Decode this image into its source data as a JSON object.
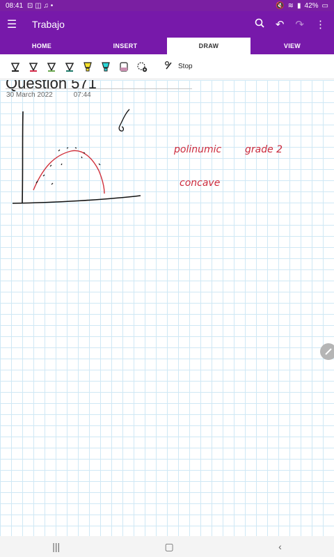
{
  "status_bar": {
    "time": "08:41",
    "battery": "42%"
  },
  "app_bar": {
    "title": "Trabajo"
  },
  "tabs": [
    "HOME",
    "INSERT",
    "DRAW",
    "VIEW"
  ],
  "toolbar": {
    "pen_colors": [
      "#222222",
      "#d62a4a",
      "#6aa84f",
      "#1f7a6a",
      "#f5e12b",
      "#2bd6d6",
      "#c98fb0"
    ],
    "stop_label": "Stop"
  },
  "page": {
    "title": "Question 571",
    "date": "30 March 2022",
    "time": "07:44"
  },
  "ink": {
    "note1": "polinumic",
    "note2": "grade 2",
    "note3": "concave"
  }
}
